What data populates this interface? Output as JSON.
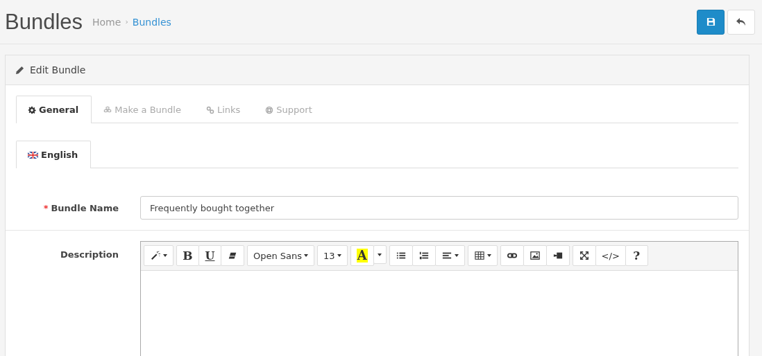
{
  "page": {
    "title": "Bundles",
    "breadcrumb": [
      {
        "label": "Home",
        "current": false
      },
      {
        "separator": "›",
        "label": "Bundles",
        "current": true
      }
    ]
  },
  "actions": [
    {
      "kind": "save"
    },
    {
      "kind": "back"
    }
  ],
  "panel": {
    "title": "Edit Bundle",
    "tabs": [
      {
        "kind": "gear",
        "label": "General",
        "selected": true
      },
      {
        "kind": "cubes",
        "label": "Make a Bundle",
        "selected": false
      },
      {
        "kind": "link",
        "label": "Links",
        "selected": false
      },
      {
        "kind": "lifebuoy",
        "label": "Support",
        "selected": false
      }
    ],
    "language_tabs": [
      {
        "label": "English",
        "selected": true
      }
    ],
    "fields": [
      {
        "required_mark": "*",
        "label": "Bundle Name",
        "value": "Frequently bought together"
      }
    ],
    "editor": {
      "label": "Description",
      "toolbar": [
        [
          {
            "kind": "wand",
            "caret": true
          }
        ],
        [
          {
            "kind": "bold",
            "label": "B",
            "caret": false
          },
          {
            "kind": "underline",
            "label": "U",
            "caret": false
          },
          {
            "kind": "eraser",
            "caret": false
          }
        ],
        [
          {
            "kind": "font",
            "label": "Open Sans",
            "caret": true
          }
        ],
        [
          {
            "kind": "size",
            "label": "13",
            "caret": true
          }
        ],
        [
          {
            "kind": "highlight",
            "label": "A",
            "caret": false
          },
          {
            "kind": "dropdown",
            "caret": true
          }
        ],
        [
          {
            "kind": "bullets",
            "caret": false
          },
          {
            "kind": "numbers",
            "caret": false
          },
          {
            "kind": "align",
            "caret": true
          }
        ],
        [
          {
            "kind": "table",
            "caret": true
          }
        ],
        [
          {
            "kind": "link",
            "caret": false
          },
          {
            "kind": "picture",
            "caret": false
          },
          {
            "kind": "video",
            "caret": false
          }
        ],
        [
          {
            "kind": "fullscreen",
            "caret": false
          },
          {
            "kind": "code",
            "label": "</>",
            "caret": false
          },
          {
            "kind": "help",
            "label": "?",
            "caret": false
          }
        ]
      ]
    }
  }
}
